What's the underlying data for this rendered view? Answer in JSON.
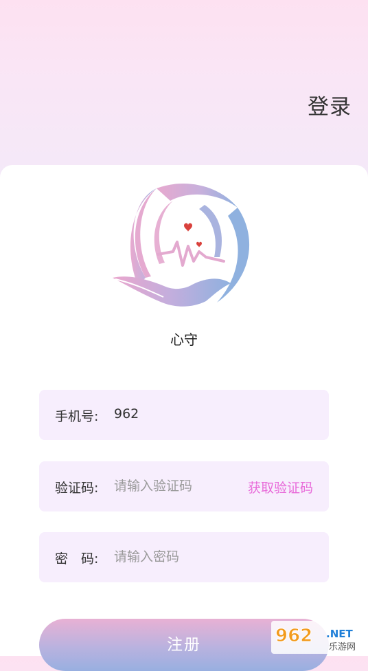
{
  "header": {
    "login_label": "登录"
  },
  "brand": {
    "app_name": "心守",
    "colors": {
      "pink": "#e3a9cf",
      "blue": "#8fb1df",
      "heart": "#d9413c"
    }
  },
  "form": {
    "phone": {
      "label": "手机号:",
      "value": "962"
    },
    "code": {
      "label": "验证码:",
      "placeholder": "请输入验证码",
      "action_label": "获取验证码"
    },
    "password": {
      "label": "密　码:",
      "placeholder": "请输入密码"
    }
  },
  "register_label": "注册",
  "watermark": {
    "number": "962",
    "suffix": ".NET",
    "subtitle": "乐游网"
  },
  "colors": {
    "field_bg": "#f7eefd",
    "accent": "#e86ad9"
  }
}
